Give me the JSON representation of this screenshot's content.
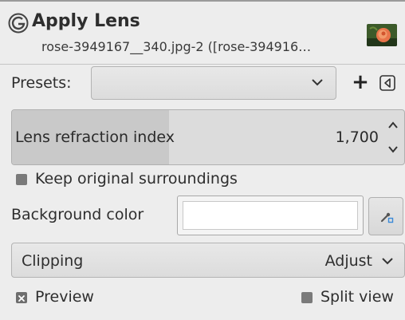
{
  "header": {
    "title": "Apply Lens",
    "subtitle": "rose-3949167__340.jpg-2 ([rose-394916…"
  },
  "presets": {
    "label": "Presets:",
    "value": "",
    "add_label": "+"
  },
  "refraction": {
    "label": "Lens refraction index",
    "value": "1,700",
    "fraction": 0.4
  },
  "keep_surroundings": {
    "label": "Keep original surroundings",
    "checked": false
  },
  "background": {
    "label": "Background color",
    "color": "#ffffff"
  },
  "clipping": {
    "label": "Clipping",
    "value": "Adjust"
  },
  "preview": {
    "label": "Preview",
    "checked": true
  },
  "split_view": {
    "label": "Split view",
    "checked": false
  },
  "icons": {
    "app": "gimp-icon",
    "thumbnail": "image-thumbnail-icon",
    "presets_menu": "menu-triangle-icon",
    "picker": "eyedropper-icon"
  }
}
